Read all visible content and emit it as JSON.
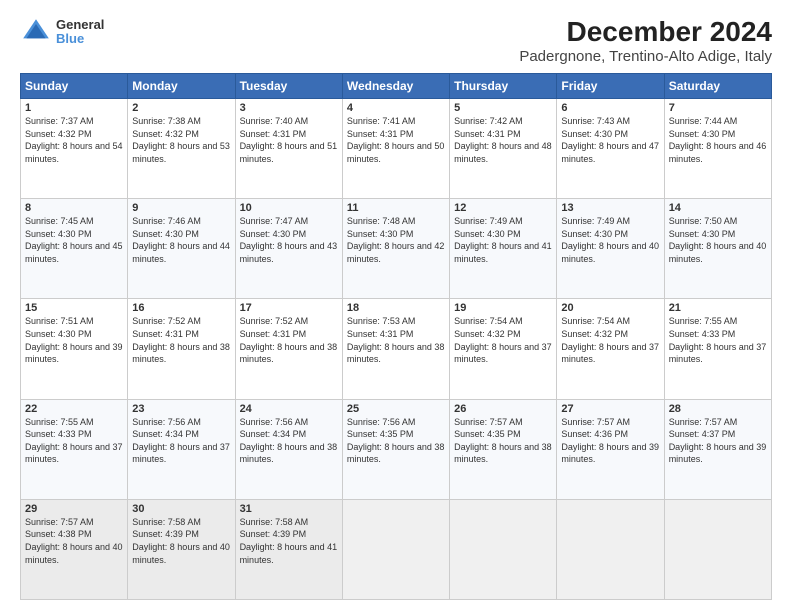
{
  "header": {
    "logo_line1": "General",
    "logo_line2": "Blue",
    "title": "December 2024",
    "subtitle": "Padergnone, Trentino-Alto Adige, Italy"
  },
  "columns": [
    "Sunday",
    "Monday",
    "Tuesday",
    "Wednesday",
    "Thursday",
    "Friday",
    "Saturday"
  ],
  "weeks": [
    [
      {
        "day": "1",
        "sunrise": "Sunrise: 7:37 AM",
        "sunset": "Sunset: 4:32 PM",
        "daylight": "Daylight: 8 hours and 54 minutes."
      },
      {
        "day": "2",
        "sunrise": "Sunrise: 7:38 AM",
        "sunset": "Sunset: 4:32 PM",
        "daylight": "Daylight: 8 hours and 53 minutes."
      },
      {
        "day": "3",
        "sunrise": "Sunrise: 7:40 AM",
        "sunset": "Sunset: 4:31 PM",
        "daylight": "Daylight: 8 hours and 51 minutes."
      },
      {
        "day": "4",
        "sunrise": "Sunrise: 7:41 AM",
        "sunset": "Sunset: 4:31 PM",
        "daylight": "Daylight: 8 hours and 50 minutes."
      },
      {
        "day": "5",
        "sunrise": "Sunrise: 7:42 AM",
        "sunset": "Sunset: 4:31 PM",
        "daylight": "Daylight: 8 hours and 48 minutes."
      },
      {
        "day": "6",
        "sunrise": "Sunrise: 7:43 AM",
        "sunset": "Sunset: 4:30 PM",
        "daylight": "Daylight: 8 hours and 47 minutes."
      },
      {
        "day": "7",
        "sunrise": "Sunrise: 7:44 AM",
        "sunset": "Sunset: 4:30 PM",
        "daylight": "Daylight: 8 hours and 46 minutes."
      }
    ],
    [
      {
        "day": "8",
        "sunrise": "Sunrise: 7:45 AM",
        "sunset": "Sunset: 4:30 PM",
        "daylight": "Daylight: 8 hours and 45 minutes."
      },
      {
        "day": "9",
        "sunrise": "Sunrise: 7:46 AM",
        "sunset": "Sunset: 4:30 PM",
        "daylight": "Daylight: 8 hours and 44 minutes."
      },
      {
        "day": "10",
        "sunrise": "Sunrise: 7:47 AM",
        "sunset": "Sunset: 4:30 PM",
        "daylight": "Daylight: 8 hours and 43 minutes."
      },
      {
        "day": "11",
        "sunrise": "Sunrise: 7:48 AM",
        "sunset": "Sunset: 4:30 PM",
        "daylight": "Daylight: 8 hours and 42 minutes."
      },
      {
        "day": "12",
        "sunrise": "Sunrise: 7:49 AM",
        "sunset": "Sunset: 4:30 PM",
        "daylight": "Daylight: 8 hours and 41 minutes."
      },
      {
        "day": "13",
        "sunrise": "Sunrise: 7:49 AM",
        "sunset": "Sunset: 4:30 PM",
        "daylight": "Daylight: 8 hours and 40 minutes."
      },
      {
        "day": "14",
        "sunrise": "Sunrise: 7:50 AM",
        "sunset": "Sunset: 4:30 PM",
        "daylight": "Daylight: 8 hours and 40 minutes."
      }
    ],
    [
      {
        "day": "15",
        "sunrise": "Sunrise: 7:51 AM",
        "sunset": "Sunset: 4:30 PM",
        "daylight": "Daylight: 8 hours and 39 minutes."
      },
      {
        "day": "16",
        "sunrise": "Sunrise: 7:52 AM",
        "sunset": "Sunset: 4:31 PM",
        "daylight": "Daylight: 8 hours and 38 minutes."
      },
      {
        "day": "17",
        "sunrise": "Sunrise: 7:52 AM",
        "sunset": "Sunset: 4:31 PM",
        "daylight": "Daylight: 8 hours and 38 minutes."
      },
      {
        "day": "18",
        "sunrise": "Sunrise: 7:53 AM",
        "sunset": "Sunset: 4:31 PM",
        "daylight": "Daylight: 8 hours and 38 minutes."
      },
      {
        "day": "19",
        "sunrise": "Sunrise: 7:54 AM",
        "sunset": "Sunset: 4:32 PM",
        "daylight": "Daylight: 8 hours and 37 minutes."
      },
      {
        "day": "20",
        "sunrise": "Sunrise: 7:54 AM",
        "sunset": "Sunset: 4:32 PM",
        "daylight": "Daylight: 8 hours and 37 minutes."
      },
      {
        "day": "21",
        "sunrise": "Sunrise: 7:55 AM",
        "sunset": "Sunset: 4:33 PM",
        "daylight": "Daylight: 8 hours and 37 minutes."
      }
    ],
    [
      {
        "day": "22",
        "sunrise": "Sunrise: 7:55 AM",
        "sunset": "Sunset: 4:33 PM",
        "daylight": "Daylight: 8 hours and 37 minutes."
      },
      {
        "day": "23",
        "sunrise": "Sunrise: 7:56 AM",
        "sunset": "Sunset: 4:34 PM",
        "daylight": "Daylight: 8 hours and 37 minutes."
      },
      {
        "day": "24",
        "sunrise": "Sunrise: 7:56 AM",
        "sunset": "Sunset: 4:34 PM",
        "daylight": "Daylight: 8 hours and 38 minutes."
      },
      {
        "day": "25",
        "sunrise": "Sunrise: 7:56 AM",
        "sunset": "Sunset: 4:35 PM",
        "daylight": "Daylight: 8 hours and 38 minutes."
      },
      {
        "day": "26",
        "sunrise": "Sunrise: 7:57 AM",
        "sunset": "Sunset: 4:35 PM",
        "daylight": "Daylight: 8 hours and 38 minutes."
      },
      {
        "day": "27",
        "sunrise": "Sunrise: 7:57 AM",
        "sunset": "Sunset: 4:36 PM",
        "daylight": "Daylight: 8 hours and 39 minutes."
      },
      {
        "day": "28",
        "sunrise": "Sunrise: 7:57 AM",
        "sunset": "Sunset: 4:37 PM",
        "daylight": "Daylight: 8 hours and 39 minutes."
      }
    ],
    [
      {
        "day": "29",
        "sunrise": "Sunrise: 7:57 AM",
        "sunset": "Sunset: 4:38 PM",
        "daylight": "Daylight: 8 hours and 40 minutes."
      },
      {
        "day": "30",
        "sunrise": "Sunrise: 7:58 AM",
        "sunset": "Sunset: 4:39 PM",
        "daylight": "Daylight: 8 hours and 40 minutes."
      },
      {
        "day": "31",
        "sunrise": "Sunrise: 7:58 AM",
        "sunset": "Sunset: 4:39 PM",
        "daylight": "Daylight: 8 hours and 41 minutes."
      },
      null,
      null,
      null,
      null
    ]
  ]
}
